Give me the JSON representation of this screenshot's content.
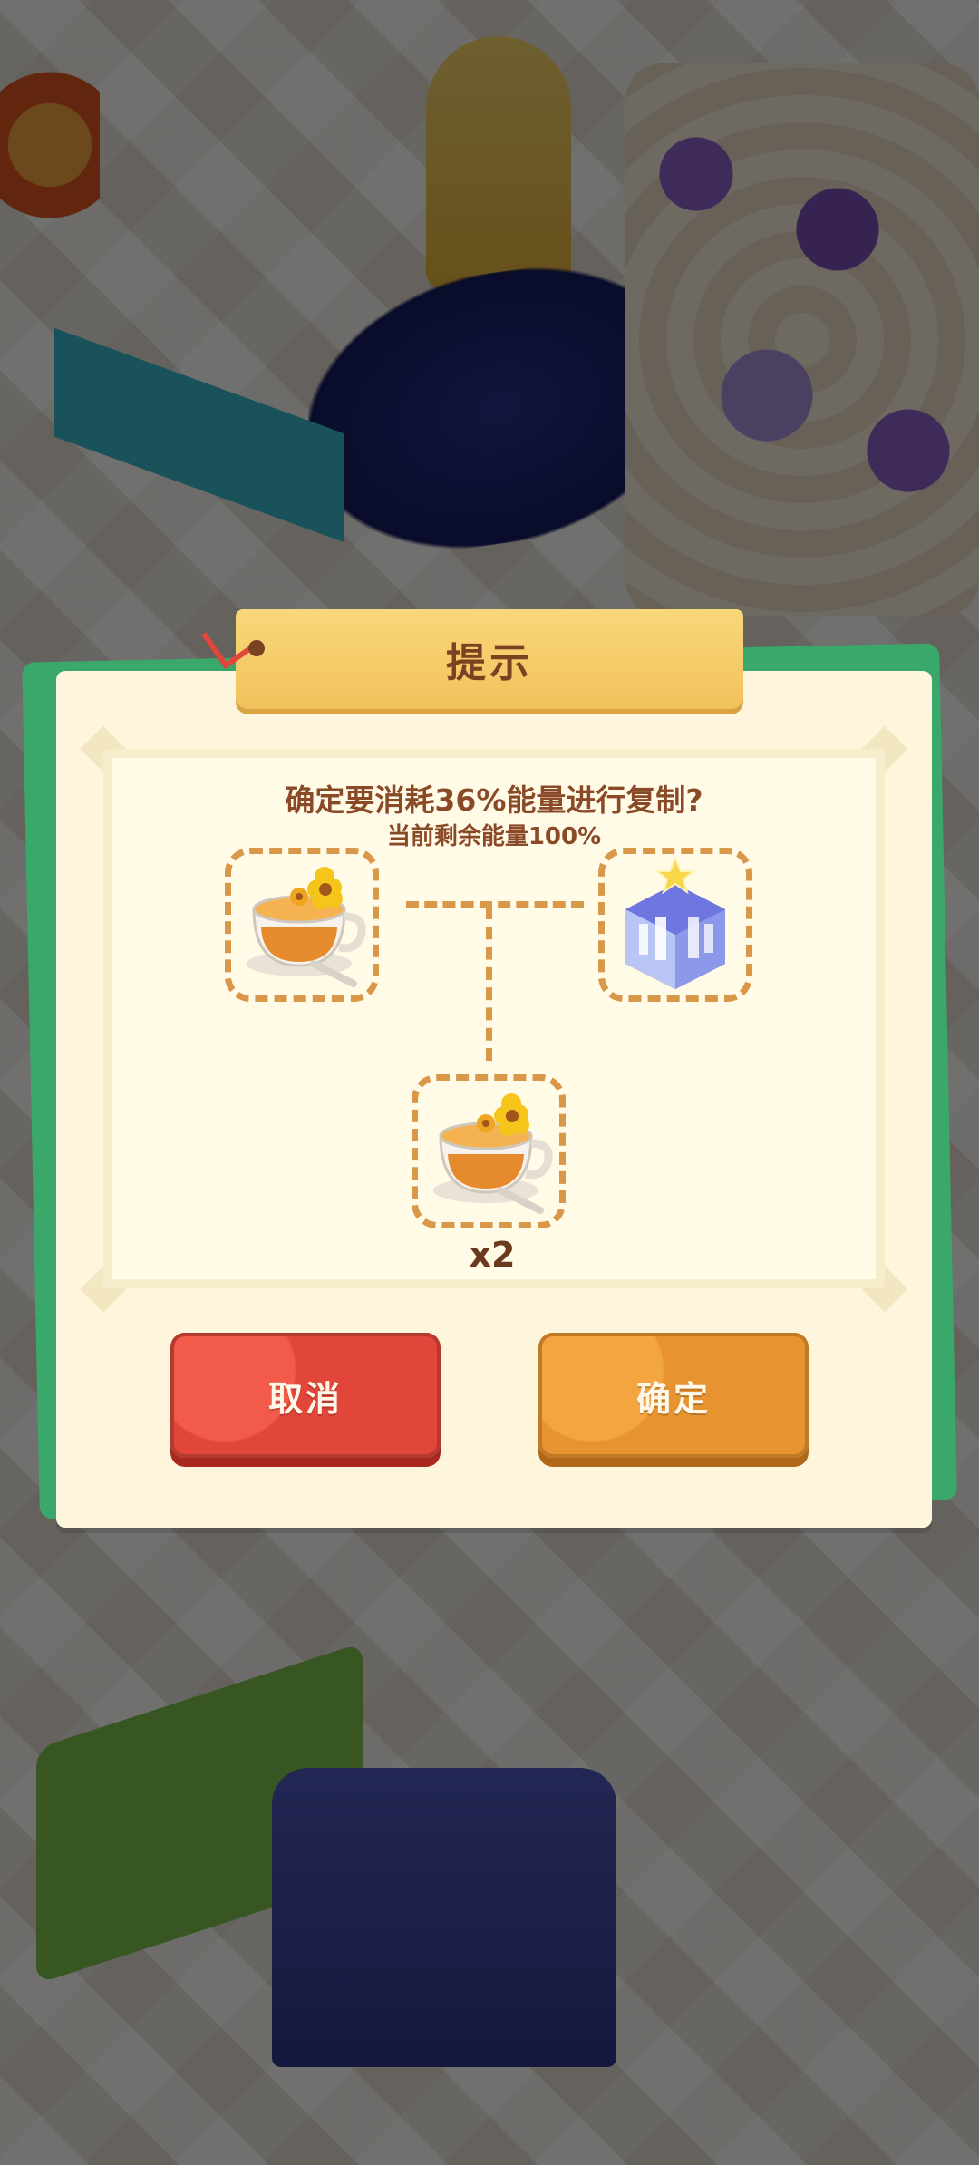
{
  "dialog": {
    "title": "提示",
    "question": "确定要消耗36%能量进行复制?",
    "remaining": "当前剩余能量100%",
    "source_item_icon": "tea-cup-with-flower-icon",
    "catalyst_item_icon": "crystal-palace-cube-icon",
    "result_item_icon": "tea-cup-with-flower-icon",
    "result_multiplier": "x2",
    "cancel_label": "取消",
    "confirm_label": "确定"
  },
  "colors": {
    "cancel": "#e2453a",
    "confirm": "#e69330",
    "title_tab": "#f2c25c",
    "text_brown": "#8a4a28",
    "dash_border": "#d9974a"
  }
}
